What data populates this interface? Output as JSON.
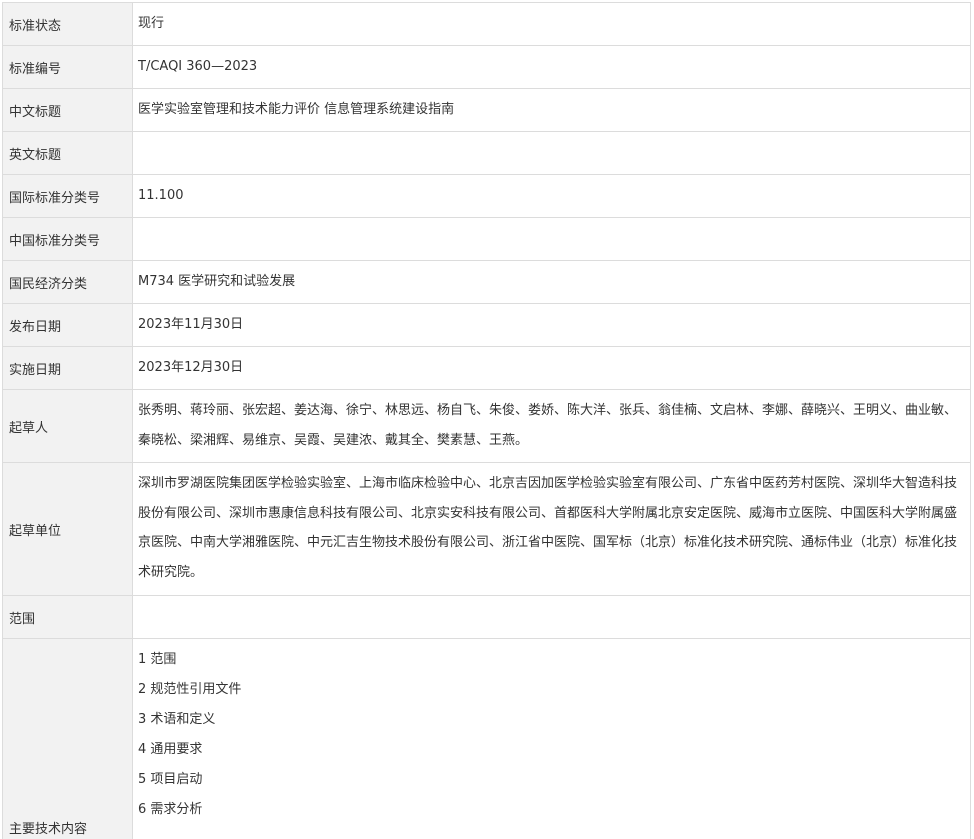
{
  "rows": [
    {
      "label": "标准状态",
      "value": "现行"
    },
    {
      "label": "标准编号",
      "value": "T/CAQI 360—2023"
    },
    {
      "label": "中文标题",
      "value": "医学实验室管理和技术能力评价 信息管理系统建设指南"
    },
    {
      "label": "英文标题",
      "value": ""
    },
    {
      "label": "国际标准分类号",
      "value": "11.100"
    },
    {
      "label": "中国标准分类号",
      "value": ""
    },
    {
      "label": "国民经济分类",
      "value": "M734 医学研究和试验发展"
    },
    {
      "label": "发布日期",
      "value": "2023年11月30日"
    },
    {
      "label": "实施日期",
      "value": "2023年12月30日"
    },
    {
      "label": "起草人",
      "value": "张秀明、蒋玲丽、张宏超、姜达海、徐宁、林思远、杨自飞、朱俊、娄娇、陈大洋、张兵、翁佳楠、文启林、李娜、薛晓兴、王明义、曲业敏、秦晓松、梁湘辉、易维京、吴霞、吴建浓、戴其全、樊素慧、王燕。"
    },
    {
      "label": "起草单位",
      "value": "深圳市罗湖医院集团医学检验实验室、上海市临床检验中心、北京吉因加医学检验实验室有限公司、广东省中医药芳村医院、深圳华大智造科技股份有限公司、深圳市惠康信息科技有限公司、北京实安科技有限公司、首都医科大学附属北京安定医院、威海市立医院、中国医科大学附属盛京医院、中南大学湘雅医院、中元汇吉生物技术股份有限公司、浙江省中医院、国军标（北京）标准化技术研究院、通标伟业（北京）标准化技术研究院。"
    },
    {
      "label": "范围",
      "value": ""
    },
    {
      "label": "主要技术内容",
      "toc": [
        "1 范围",
        "2 规范性引用文件",
        "3 术语和定义",
        "4 通用要求",
        "5 项目启动",
        "6 需求分析"
      ]
    }
  ]
}
